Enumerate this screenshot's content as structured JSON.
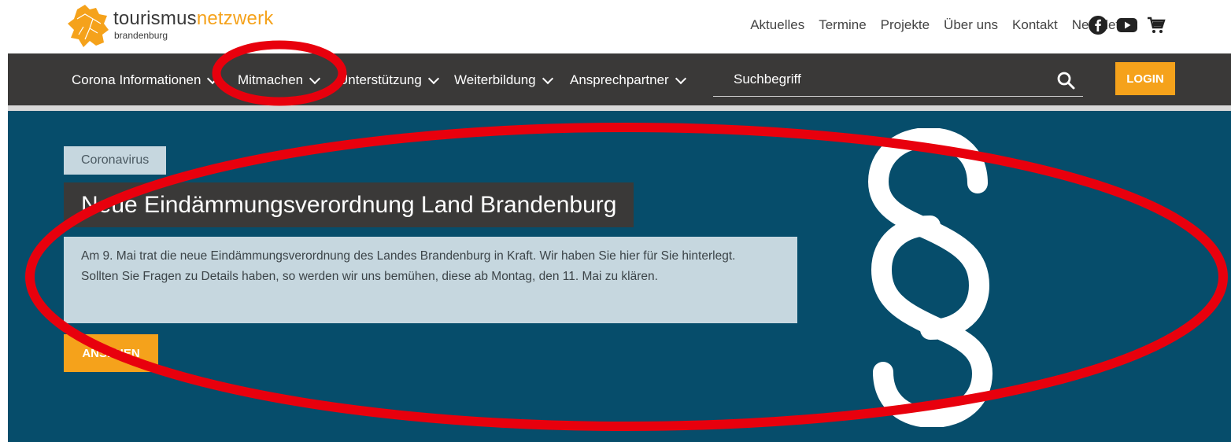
{
  "brand": {
    "name_part1": "tourismus",
    "name_part2": "netzwerk",
    "sub": "brandenburg"
  },
  "toplinks": [
    "Aktuelles",
    "Termine",
    "Projekte",
    "Über uns",
    "Kontakt",
    "Newsletter"
  ],
  "social_icons": [
    "facebook-icon",
    "youtube-icon",
    "cart-icon"
  ],
  "nav": {
    "items": [
      "Corona Informationen",
      "Mitmachen",
      "Unterstützung",
      "Weiterbildung",
      "Ansprechpartner"
    ],
    "search_placeholder": "Suchbegriff",
    "login_label": "LOGIN"
  },
  "hero": {
    "tag": "Coronavirus",
    "title": "Neue Eindämmungsverordnung Land Brandenburg",
    "description": "Am 9. Mai trat die neue Eindämmungsverordnung des Landes Brandenburg in Kraft. Wir haben Sie hier für Sie hinterlegt. Sollten Sie Fragen zu Details haben, so werden wir uns bemühen, diese ab Montag, den 11. Mai zu klären.",
    "cta_label": "ANSEHEN",
    "symbol": "§"
  },
  "colors": {
    "accent": "#f5a21b",
    "nav_bg": "#3a3938",
    "hero_bg": "#064d6b",
    "annotation": "#e8000d"
  }
}
